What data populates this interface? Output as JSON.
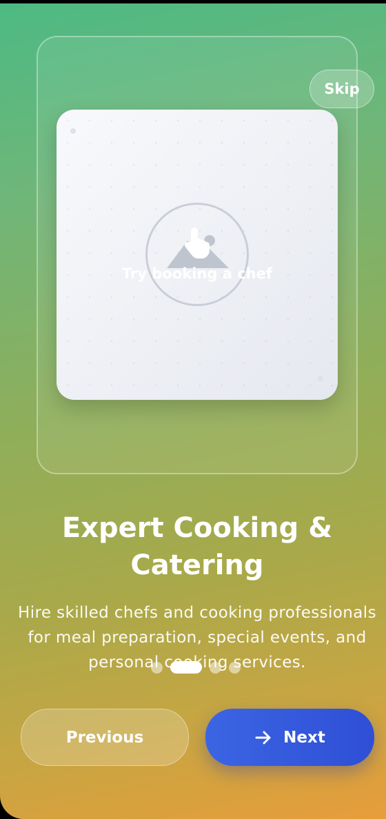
{
  "onboarding": {
    "skip_label": "Skip",
    "image_hint": "Try booking a chef",
    "title": "Expert Cooking & Catering",
    "description": "Hire skilled chefs and cooking professionals for meal preparation, special events, and personal cooking services.",
    "pager": {
      "total": 4,
      "current": 2
    },
    "previous_label": "Previous",
    "next_label": "Next"
  },
  "icons": {
    "image_placeholder": "mountain-icon",
    "tap": "hand-tap-icon",
    "next": "arrow-right-icon"
  },
  "colors": {
    "gradient_top": "#4dba83",
    "gradient_bottom": "#e79d3a",
    "next_button": "#3b65e3"
  }
}
